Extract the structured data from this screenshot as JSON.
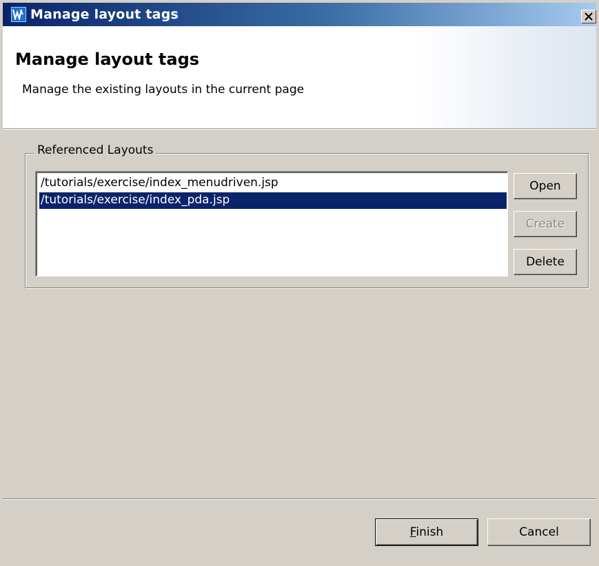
{
  "window": {
    "title": "Manage layout tags"
  },
  "banner": {
    "title": "Manage layout tags",
    "description": "Manage the existing layouts in the current page"
  },
  "group": {
    "label": "Referenced Layouts"
  },
  "list": {
    "items": [
      {
        "label": "/tutorials/exercise/index_menudriven.jsp",
        "selected": false
      },
      {
        "label": "/tutorials/exercise/index_pda.jsp",
        "selected": true
      }
    ]
  },
  "side_buttons": {
    "open": "Open",
    "create": "Create",
    "delete": "Delete"
  },
  "footer": {
    "finish_label": "Finish",
    "finish_mnemonic": "F",
    "finish_rest": "inish",
    "cancel_label": "Cancel"
  },
  "colors": {
    "titlebar_start": "#0a246a",
    "titlebar_end": "#a6caf0",
    "selection": "#0a246a",
    "dialog_bg": "#d4d0c8"
  },
  "icons": {
    "app": "app-logo-icon",
    "close": "close-icon"
  }
}
